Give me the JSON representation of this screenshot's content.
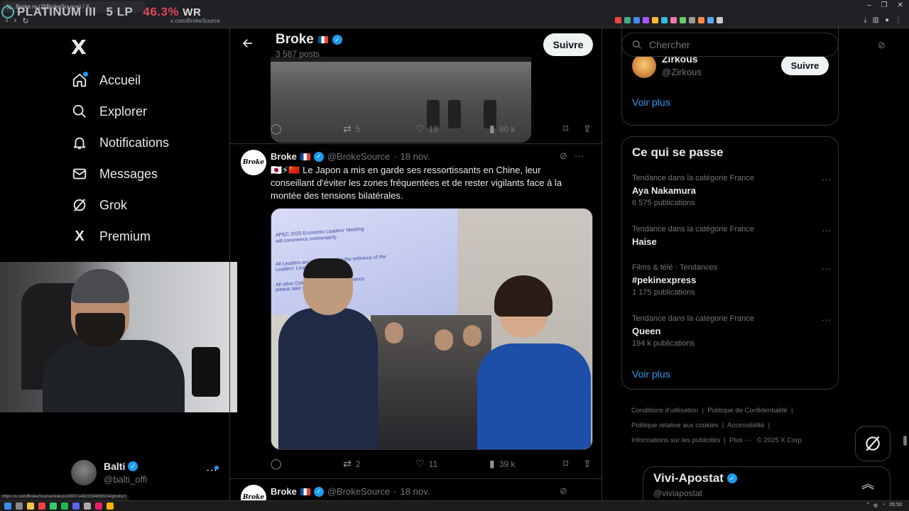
{
  "browser": {
    "tab_title": "Broke.re (@BrokeSource) / X",
    "url": "x.com/BrokeSource",
    "status_url": "https://x.com/BrokeSource/status/1990714923194659234/photo/1",
    "overlay": {
      "rank": "PLATINUM III",
      "lp": "5 LP",
      "wr_value": "46.3%",
      "wr_label": "WR"
    },
    "clock": "05:50"
  },
  "left_nav": {
    "logo": "X",
    "items": [
      {
        "label": "Accueil",
        "icon": "home-icon"
      },
      {
        "label": "Explorer",
        "icon": "search-icon"
      },
      {
        "label": "Notifications",
        "icon": "bell-icon"
      },
      {
        "label": "Messages",
        "icon": "mail-icon"
      },
      {
        "label": "Grok",
        "icon": "grok-icon"
      },
      {
        "label": "Premium",
        "icon": "x-premium-icon"
      }
    ],
    "profile": {
      "name": "Balti",
      "handle": "@balti_offi",
      "more": "···"
    }
  },
  "header": {
    "title": "Broke",
    "posts": "3 587 posts",
    "follow_label": "Suivre"
  },
  "tweets": [
    {
      "replies": "",
      "retweets": "5",
      "likes": "19",
      "views": "80 k"
    },
    {
      "avatar_text": "Broke",
      "name": "Broke",
      "handle": "@BrokeSource",
      "date": "18 nov.",
      "text": "🇯🇵⚡🇨🇳 Le Japon a mis en garde ses ressortissants en Chine, leur conseillant d'éviter les zones fréquentées et de rester vigilants face à la montée des tensions bilatérales.",
      "image_screen_lines": [
        "APEC 2025 Economic Leaders' Meeting",
        "will commence momentarily.",
        "All Leaders are kin    to gather at the entrance of the",
        "Leaders' Lounge            entrance.",
        "All other Dele           Meeting Room in advance.",
        "please take y"
      ],
      "replies": "",
      "retweets": "2",
      "likes": "11",
      "views": "39 k"
    },
    {
      "avatar_text": "Broke",
      "name": "Broke",
      "handle": "@BrokeSource",
      "date": "18 nov."
    }
  ],
  "right": {
    "search_placeholder": "Chercher",
    "who_to_follow": {
      "name": "Zirkous",
      "handle": "@Zirkous",
      "follow_label": "Suivre",
      "more": "Voir plus"
    },
    "trending": {
      "title": "Ce qui se passe",
      "items": [
        {
          "context": "Tendance dans la catégorie France",
          "name": "Aya Nakamura",
          "count": "6 575 publications"
        },
        {
          "context": "Tendance dans la catégorie France",
          "name": "Haise",
          "count": ""
        },
        {
          "context": "Films & télé · Tendances",
          "name": "#pekinexpress",
          "count": "1 175 publications"
        },
        {
          "context": "Tendance dans la catégorie France",
          "name": "Queen",
          "count": "194 k publications"
        }
      ],
      "more": "Voir plus"
    },
    "footer": {
      "links": [
        "Conditions d'utilisation",
        "Politique de Confidentialité",
        "Politique relative aux cookies",
        "Accessibilité",
        "Informations sur les publicités",
        "Plus ···"
      ],
      "copyright": "© 2025 X Corp."
    },
    "message_drawer": {
      "name": "Vivi-Apostat",
      "handle": "@viviapostat"
    }
  },
  "colors": {
    "accent": "#1d9bf0",
    "background": "#000000",
    "muted": "#71767b",
    "border": "#2f3336"
  }
}
